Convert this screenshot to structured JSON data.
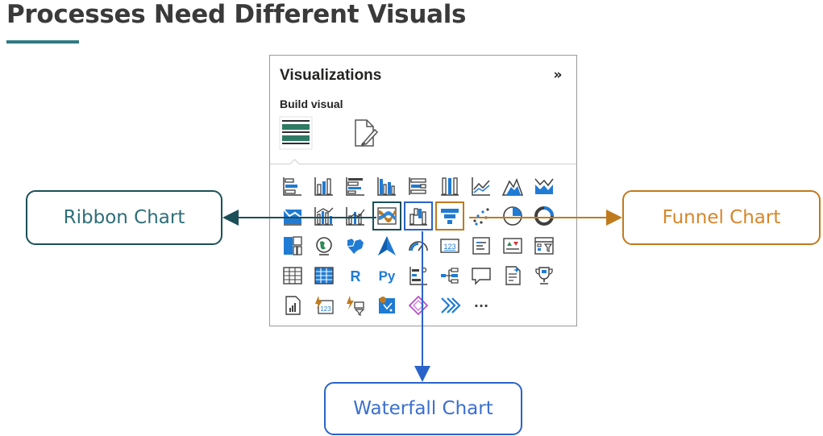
{
  "page": {
    "title": "Processes Need Different Visuals"
  },
  "panel": {
    "title": "Visualizations",
    "collapse_glyph": "»",
    "subtitle": "Build visual",
    "tabs": [
      {
        "name": "fields-tab",
        "icon": "build-visual-icon",
        "selected": true
      },
      {
        "name": "format-tab",
        "icon": "format-paintbrush-icon",
        "selected": false
      }
    ],
    "grid_rows": [
      [
        "stacked-bar-chart-icon",
        "stacked-column-chart-icon",
        "clustered-bar-chart-icon",
        "clustered-column-chart-icon",
        "100-stacked-bar-chart-icon",
        "100-stacked-column-chart-icon",
        "line-chart-icon",
        "area-chart-icon",
        "stacked-area-chart-icon"
      ],
      [
        "line-and-stacked-column-chart-icon",
        "line-and-clustered-column-chart-icon",
        "line-and-clustered-column-chart-2-icon",
        "ribbon-chart-icon",
        "waterfall-chart-icon",
        "funnel-chart-icon",
        "scatter-chart-icon",
        "pie-chart-icon",
        "donut-chart-icon"
      ],
      [
        "treemap-icon",
        "map-icon",
        "filled-map-icon",
        "azure-map-icon",
        "gauge-icon",
        "card-icon",
        "multi-row-card-icon",
        "kpi-icon",
        "slicer-icon"
      ],
      [
        "table-icon",
        "matrix-icon",
        "r-script-visual-icon",
        "python-visual-icon",
        "key-influencers-icon",
        "decomposition-tree-icon",
        "qa-icon",
        "smart-narrative-icon",
        "metrics-icon"
      ],
      [
        "paginated-report-icon",
        "power-apps-icon",
        "power-automate-icon",
        "arcgis-map-icon",
        "power-bi-visual-icon",
        "sparkline-icon",
        "more-visuals-icon"
      ]
    ],
    "more_label": "···"
  },
  "callouts": {
    "ribbon": "Ribbon Chart",
    "funnel": "Funnel Chart",
    "waterfall": "Waterfall Chart"
  },
  "colors": {
    "ribbon": "#1b4f58",
    "waterfall": "#2a63c9",
    "funnel": "#c07a1e",
    "icon_blue": "#1f7bd4",
    "icon_dark": "#404040"
  }
}
